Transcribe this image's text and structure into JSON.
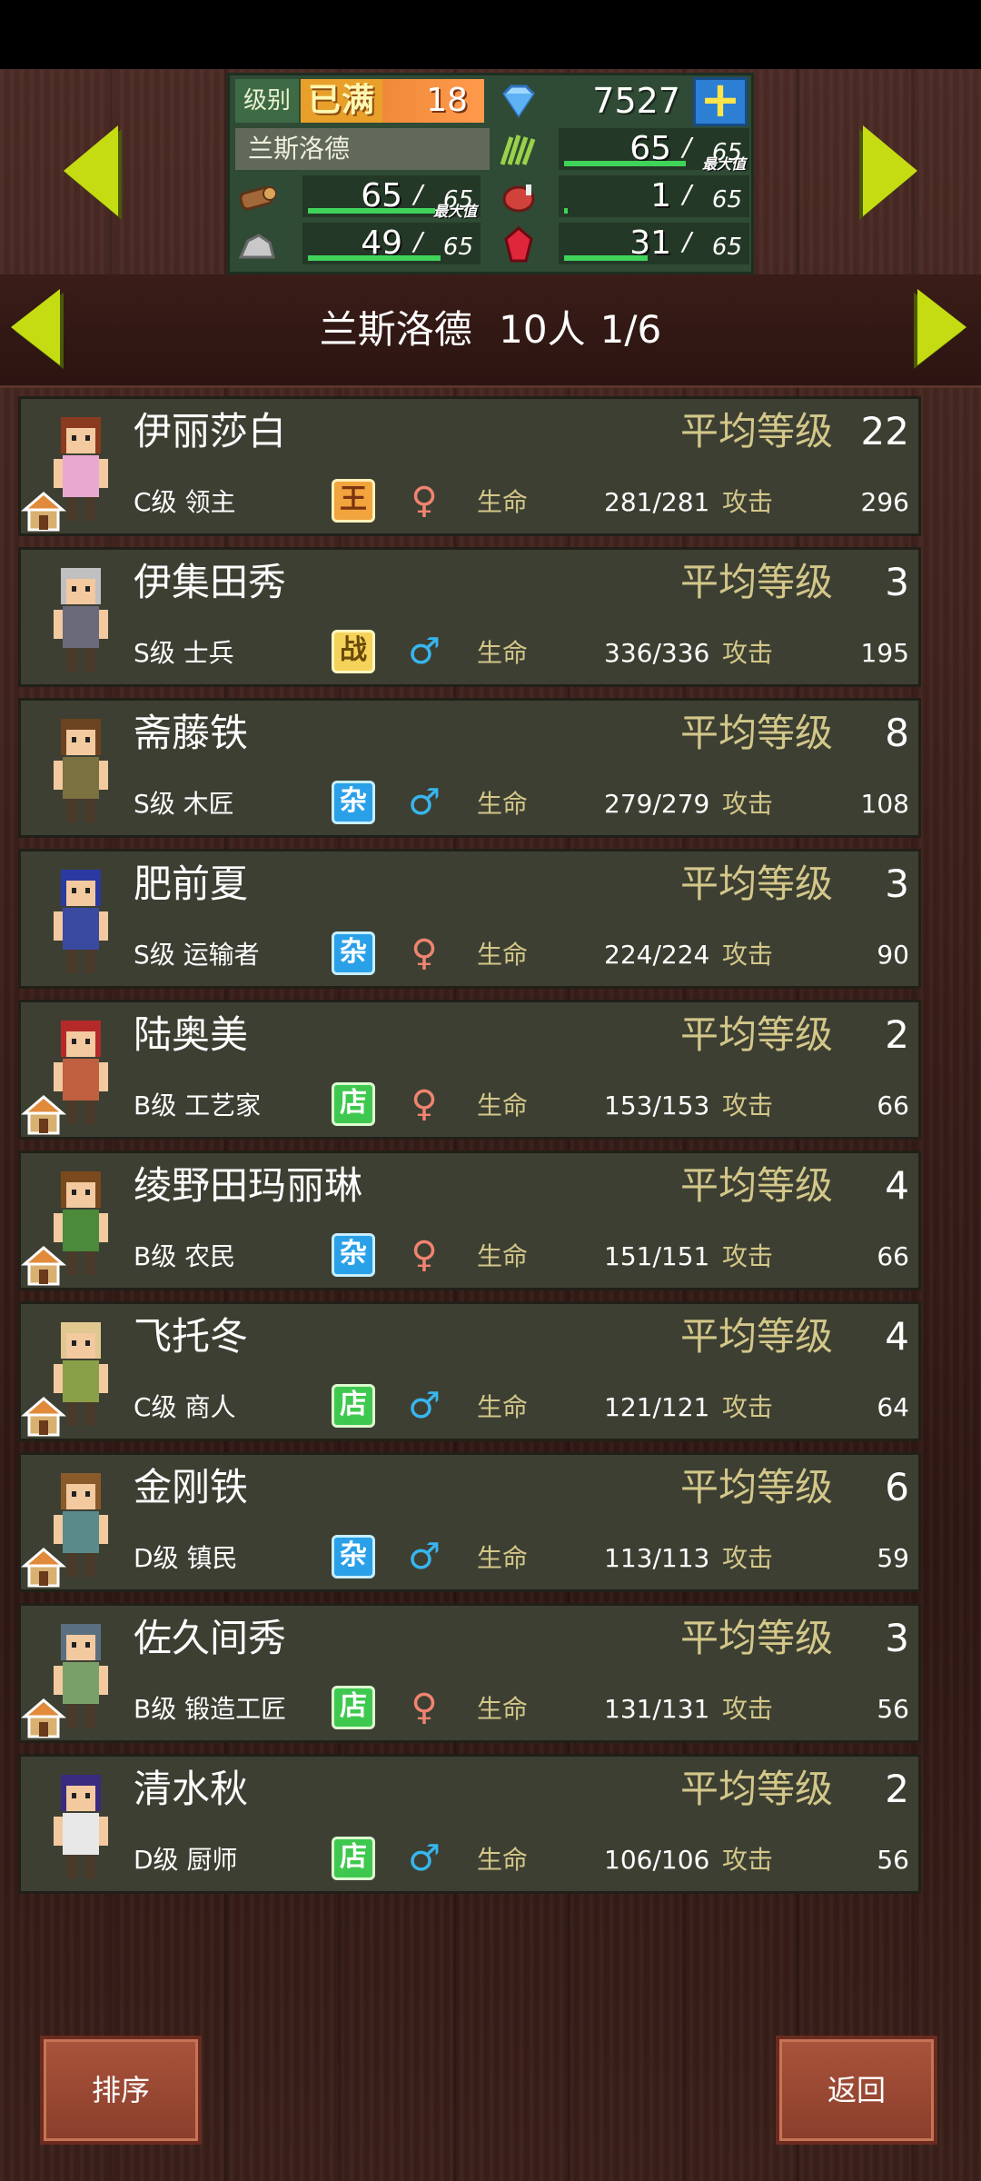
{
  "status_bar": {},
  "stats": {
    "level_label": "级别",
    "level_max_label": "已满",
    "level_value": "18",
    "gems": "7527",
    "town_name": "兰斯洛德",
    "resources": [
      {
        "name": "grass",
        "value": "65",
        "max": "65",
        "fill": 1.0,
        "maxed_tag": "最大值"
      },
      {
        "name": "wood",
        "value": "65",
        "max": "65",
        "fill": 1.0,
        "maxed_tag": "最大值"
      },
      {
        "name": "meat",
        "value": "1",
        "max": "65",
        "fill": 0.02,
        "maxed_tag": ""
      },
      {
        "name": "stone",
        "value": "49",
        "max": "65",
        "fill": 0.75,
        "maxed_tag": ""
      },
      {
        "name": "ruby",
        "value": "31",
        "max": "65",
        "fill": 0.48,
        "maxed_tag": ""
      }
    ],
    "slash": "/"
  },
  "header": {
    "town": "兰斯洛德",
    "count": "10人",
    "page": "1/6"
  },
  "labels": {
    "avg_level": "平均等级",
    "hp": "生命",
    "atk": "攻击"
  },
  "residents": [
    {
      "name": "伊丽莎白",
      "level": "22",
      "grade": "C级 领主",
      "job": "王",
      "job_type": "king",
      "gender": "f",
      "hp": "281/281",
      "atk": "296",
      "house": true
    },
    {
      "name": "伊集田秀",
      "level": "3",
      "grade": "S级 士兵",
      "job": "战",
      "job_type": "war",
      "gender": "m",
      "hp": "336/336",
      "atk": "195",
      "house": false
    },
    {
      "name": "斋藤铁",
      "level": "8",
      "grade": "S级 木匠",
      "job": "杂",
      "job_type": "misc",
      "gender": "m",
      "hp": "279/279",
      "atk": "108",
      "house": false
    },
    {
      "name": "肥前夏",
      "level": "3",
      "grade": "S级 运输者",
      "job": "杂",
      "job_type": "misc",
      "gender": "f",
      "hp": "224/224",
      "atk": "90",
      "house": false
    },
    {
      "name": "陆奥美",
      "level": "2",
      "grade": "B级 工艺家",
      "job": "店",
      "job_type": "shop",
      "gender": "f",
      "hp": "153/153",
      "atk": "66",
      "house": true
    },
    {
      "name": "绫野田玛丽琳",
      "level": "4",
      "grade": "B级 农民",
      "job": "杂",
      "job_type": "misc",
      "gender": "f",
      "hp": "151/151",
      "atk": "66",
      "house": true
    },
    {
      "name": "飞托冬",
      "level": "4",
      "grade": "C级 商人",
      "job": "店",
      "job_type": "shop",
      "gender": "m",
      "hp": "121/121",
      "atk": "64",
      "house": true
    },
    {
      "name": "金刚铁",
      "level": "6",
      "grade": "D级 镇民",
      "job": "杂",
      "job_type": "misc",
      "gender": "m",
      "hp": "113/113",
      "atk": "59",
      "house": true
    },
    {
      "name": "佐久间秀",
      "level": "3",
      "grade": "B级 锻造工匠",
      "job": "店",
      "job_type": "shop",
      "gender": "f",
      "hp": "131/131",
      "atk": "56",
      "house": true
    },
    {
      "name": "清水秋",
      "level": "2",
      "grade": "D级 厨师",
      "job": "店",
      "job_type": "shop",
      "gender": "m",
      "hp": "106/106",
      "atk": "56",
      "house": false
    }
  ],
  "buttons": {
    "sort": "排序",
    "back": "返回"
  },
  "colors": {
    "accent_arrow": "#c6dc12",
    "label_gold": "#d3c789",
    "row_bg": "#3d3f33"
  }
}
